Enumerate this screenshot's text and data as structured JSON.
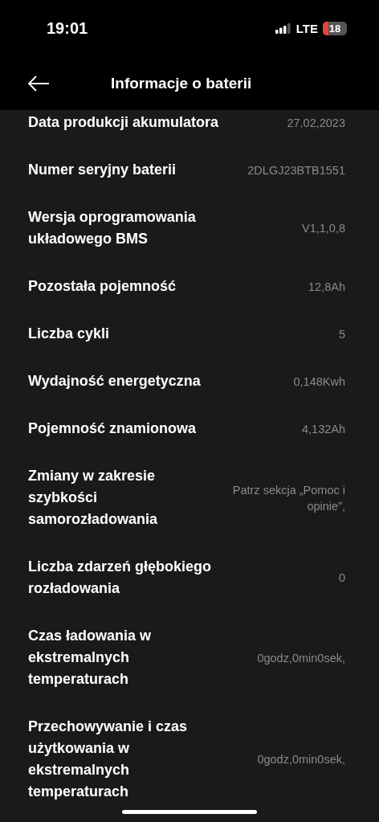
{
  "status_bar": {
    "time": "19:01",
    "network": "LTE",
    "battery": "18"
  },
  "header": {
    "title": "Informacje o baterii"
  },
  "rows": [
    {
      "label": "Data produkcji akumulatora",
      "value": "27,02,2023"
    },
    {
      "label": "Numer seryjny baterii",
      "value": "2DLGJ23BTB1551"
    },
    {
      "label": "Wersja oprogramowania układowego BMS",
      "value": "V1,1,0,8"
    },
    {
      "label": "Pozostała pojemność",
      "value": "12,8Ah"
    },
    {
      "label": "Liczba cykli",
      "value": "5"
    },
    {
      "label": "Wydajność energetyczna",
      "value": "0,148Kwh"
    },
    {
      "label": "Pojemność znamionowa",
      "value": "4,132Ah"
    },
    {
      "label": "Zmiany w zakresie szybkości samorozładowania",
      "value": "Patrz sekcja „Pomoc i opinie”,"
    },
    {
      "label": "Liczba zdarzeń głębokiego rozładowania",
      "value": "0"
    },
    {
      "label": "Czas ładowania w ekstremalnych temperaturach",
      "value": "0godz,0min0sek,"
    },
    {
      "label": "Przechowywanie i czas użytkowania w ekstremalnych temperaturach",
      "value": "0godz,0min0sek,"
    }
  ]
}
